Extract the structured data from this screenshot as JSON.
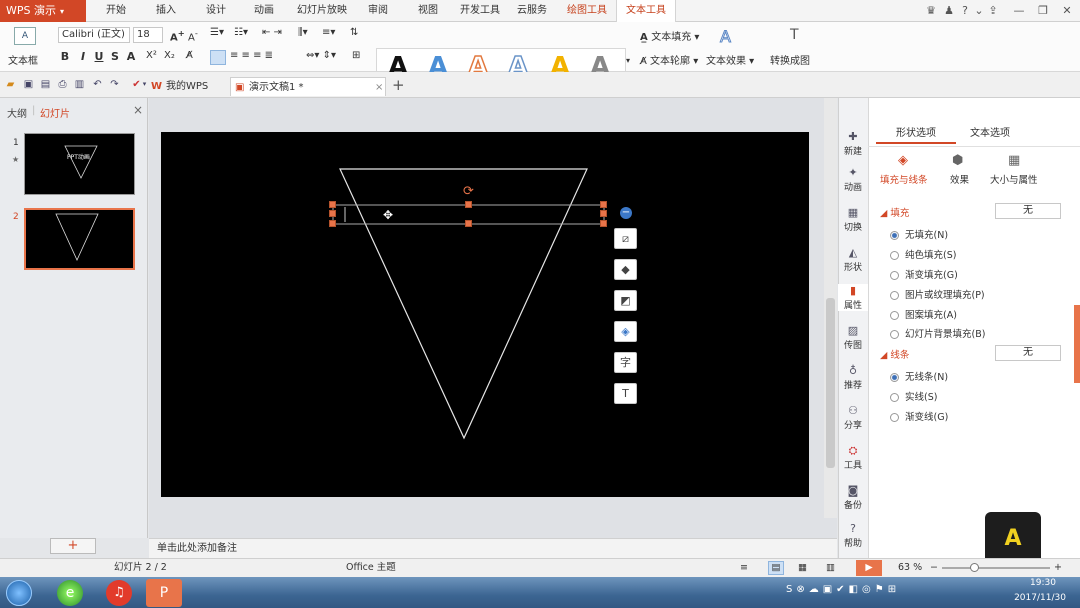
{
  "app": {
    "logo": "WPS 演示"
  },
  "menu": {
    "tabs": [
      "开始",
      "插入",
      "设计",
      "动画",
      "幻灯片放映",
      "审阅",
      "视图",
      "开发工具",
      "云服务",
      "绘图工具",
      "文本工具"
    ]
  },
  "ribbon": {
    "textbox": "文本框",
    "font_name": "Calibri (正文)",
    "font_size": "18",
    "bold": "B",
    "italic": "I",
    "underline": "U",
    "strike": "S",
    "text_fill": "文本填充",
    "text_outline": "文本轮廓",
    "text_effect": "文本效果",
    "convert": "转换成图",
    "style_letter": "A"
  },
  "tabs": {
    "mywps": "我的WPS",
    "doc": "演示文稿1 *"
  },
  "left_panel": {
    "outline": "大纲",
    "slides": "幻灯片",
    "slide1_title": "PPT动画",
    "slide1_num": "1",
    "slide2_num": "2"
  },
  "sidebar": [
    "新建",
    "动画",
    "切换",
    "形状",
    "属性",
    "传图",
    "推荐",
    "分享",
    "工具",
    "备份",
    "帮助"
  ],
  "props": {
    "tab_shape": "形状选项",
    "tab_text": "文本选项",
    "sub_fill_line": "填充与线条",
    "sub_effect": "效果",
    "sub_size": "大小与属性",
    "fill_title": "填充",
    "fill_value": "无",
    "fill_options": [
      "无填充(N)",
      "纯色填充(S)",
      "渐变填充(G)",
      "图片或纹理填充(P)",
      "图案填充(A)",
      "幻灯片背景填充(B)"
    ],
    "line_title": "线条",
    "line_value": "无",
    "line_options": [
      "无线条(N)",
      "实线(S)",
      "渐变线(G)"
    ]
  },
  "notes": "单击此处添加备注",
  "status": {
    "slide_count": "幻灯片 2 / 2",
    "theme": "Office 主题",
    "zoom": "63 %"
  },
  "clock": {
    "time": "19:30",
    "date": "2017/11/30"
  },
  "colors": {
    "accent": "#d24726",
    "selected_tab": "#c6411c"
  },
  "float_icons": [
    "shape-edit-icon",
    "fill-bucket-icon",
    "outline-icon",
    "layers-icon",
    "text-char-icon",
    "text-box-icon"
  ]
}
